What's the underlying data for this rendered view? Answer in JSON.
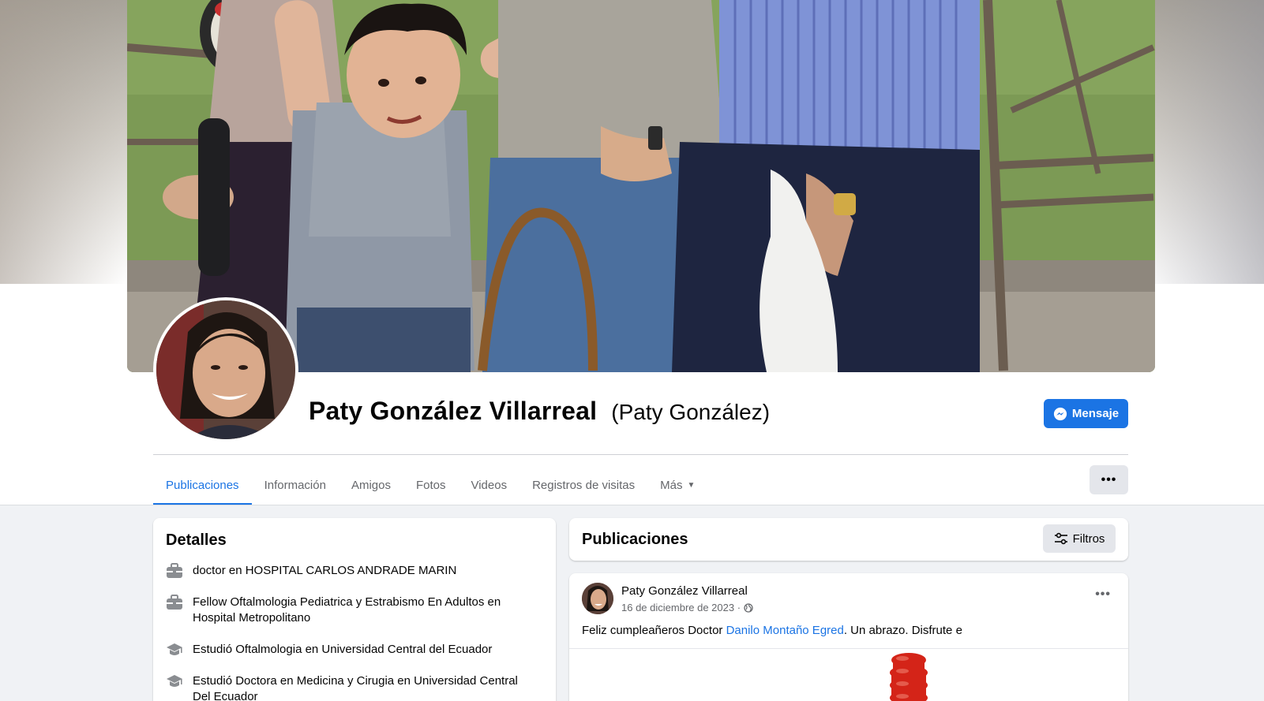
{
  "profile": {
    "name": "Paty González Villarreal",
    "alternate_name": "(Paty González)"
  },
  "actions": {
    "message_label": "Mensaje",
    "more_icon": "ellipsis-icon"
  },
  "tabs": [
    {
      "label": "Publicaciones",
      "active": true
    },
    {
      "label": "Información"
    },
    {
      "label": "Amigos"
    },
    {
      "label": "Fotos"
    },
    {
      "label": "Videos"
    },
    {
      "label": "Registros de visitas"
    },
    {
      "label": "Más"
    }
  ],
  "details": {
    "title": "Detalles",
    "items": [
      {
        "icon": "briefcase-icon",
        "prefix": "doctor en ",
        "strong": "HOSPITAL CARLOS ANDRADE MARIN"
      },
      {
        "icon": "briefcase-icon",
        "prefix": "Fellow Oftalmologia Pediatrica y Estrabismo En Adultos en Hospital Metropolitano",
        "strong": ""
      },
      {
        "icon": "graduation-cap-icon",
        "prefix": "Estudió Oftalmologia en Universidad Central del Ecuador",
        "strong": ""
      },
      {
        "icon": "graduation-cap-icon",
        "prefix": "Estudió Doctora en Medicina y Cirugia en ",
        "strong": "Universidad Central Del Ecuador"
      }
    ]
  },
  "posts": {
    "title": "Publicaciones",
    "filters_label": "Filtros",
    "post": {
      "author": "Paty González Villarreal",
      "date": "16 de diciembre de 2023 ·",
      "audience_icon": "globe-icon",
      "text_before": "Feliz cumpleañeros Doctor ",
      "mention": "Danilo Montaño Egred",
      "text_after": ". Un abrazo. Disfrute e"
    }
  },
  "colors": {
    "accent": "#1b74e4",
    "page_bg": "#f0f2f5",
    "secondary_text": "#65676b"
  }
}
